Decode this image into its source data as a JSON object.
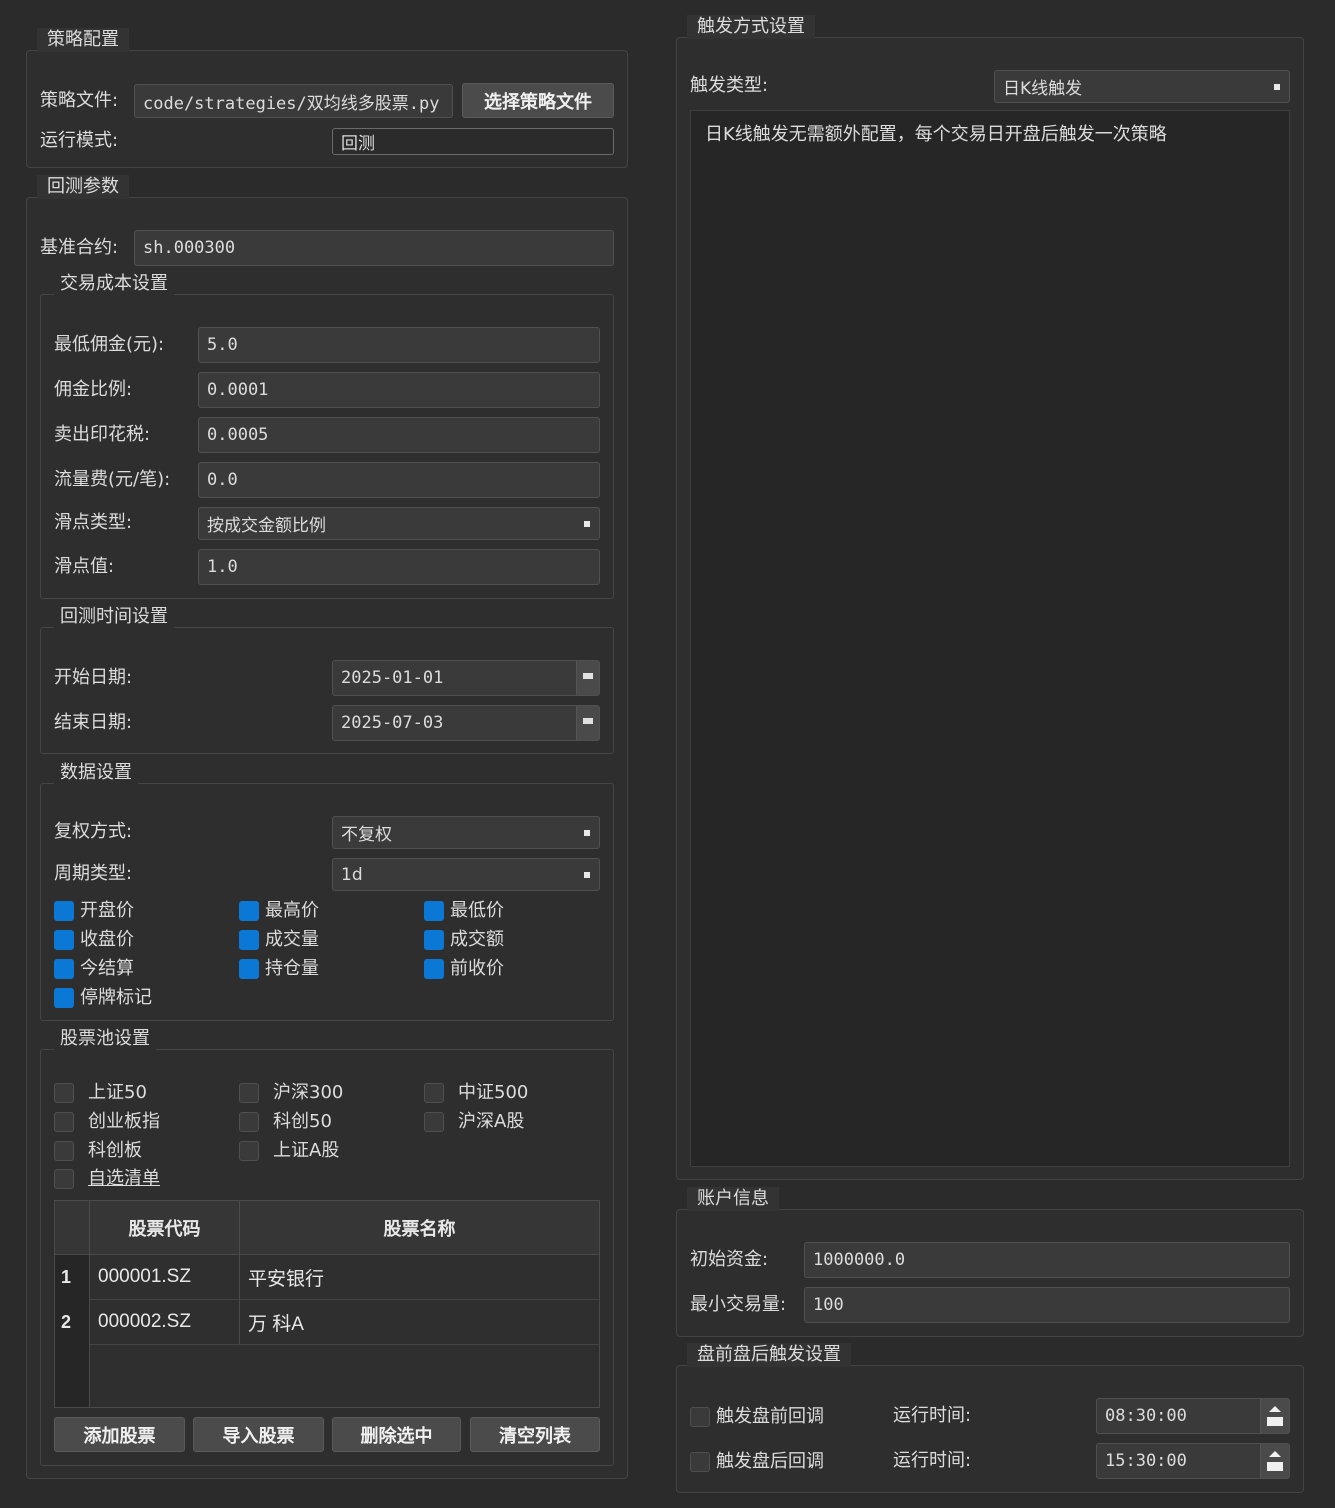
{
  "strategy": {
    "title": "策略配置",
    "file_label": "策略文件:",
    "file_value": "code/strategies/双均线多股票.py",
    "choose_button": "选择策略文件",
    "mode_label": "运行模式:",
    "mode_value": "回测"
  },
  "backtest": {
    "title": "回测参数",
    "benchmark_label": "基准合约:",
    "benchmark_value": "sh.000300",
    "cost": {
      "title": "交易成本设置",
      "min_commission_label": "最低佣金(元):",
      "min_commission_value": "5.0",
      "commission_rate_label": "佣金比例:",
      "commission_rate_value": "0.0001",
      "stamp_tax_label": "卖出印花税:",
      "stamp_tax_value": "0.0005",
      "flow_fee_label": "流量费(元/笔):",
      "flow_fee_value": "0.0",
      "slippage_type_label": "滑点类型:",
      "slippage_type_value": "按成交金额比例",
      "slippage_value_label": "滑点值:",
      "slippage_value_value": "1.0"
    },
    "time": {
      "title": "回测时间设置",
      "start_label": "开始日期:",
      "start_value": "2025-01-01",
      "end_label": "结束日期:",
      "end_value": "2025-07-03"
    },
    "data": {
      "title": "数据设置",
      "adjust_label": "复权方式:",
      "adjust_value": "不复权",
      "period_label": "周期类型:",
      "period_value": "1d",
      "fields": [
        {
          "label": "开盘价",
          "checked": true
        },
        {
          "label": "最高价",
          "checked": true
        },
        {
          "label": "最低价",
          "checked": true
        },
        {
          "label": "收盘价",
          "checked": true
        },
        {
          "label": "成交量",
          "checked": true
        },
        {
          "label": "成交额",
          "checked": true
        },
        {
          "label": "今结算",
          "checked": true
        },
        {
          "label": "持仓量",
          "checked": true
        },
        {
          "label": "前收价",
          "checked": true
        },
        {
          "label": "停牌标记",
          "checked": true
        }
      ]
    },
    "pool": {
      "title": "股票池设置",
      "options": [
        {
          "label": "上证50",
          "checked": false
        },
        {
          "label": "沪深300",
          "checked": false
        },
        {
          "label": "中证500",
          "checked": false
        },
        {
          "label": "创业板指",
          "checked": false
        },
        {
          "label": "科创50",
          "checked": false
        },
        {
          "label": "沪深A股",
          "checked": false
        },
        {
          "label": "科创板",
          "checked": false
        },
        {
          "label": "上证A股",
          "checked": false
        },
        {
          "label": "自选清单",
          "checked": false
        }
      ],
      "columns": [
        "股票代码",
        "股票名称"
      ],
      "rows": [
        {
          "index": "1",
          "code": "000001.SZ",
          "name": "平安银行"
        },
        {
          "index": "2",
          "code": "000002.SZ",
          "name": "万 科A"
        }
      ],
      "buttons": [
        "添加股票",
        "导入股票",
        "删除选中",
        "清空列表"
      ]
    }
  },
  "trigger": {
    "title": "触发方式设置",
    "type_label": "触发类型:",
    "type_value": "日K线触发",
    "description": "日K线触发无需额外配置，每个交易日开盘后触发一次策略"
  },
  "account": {
    "title": "账户信息",
    "capital_label": "初始资金:",
    "capital_value": "1000000.0",
    "min_volume_label": "最小交易量:",
    "min_volume_value": "100"
  },
  "prepost": {
    "title": "盘前盘后触发设置",
    "pre_label": "触发盘前回调",
    "pre_checked": false,
    "pre_time_label": "运行时间:",
    "pre_time_value": "08:30:00",
    "post_label": "触发盘后回调",
    "post_checked": false,
    "post_time_label": "运行时间:",
    "post_time_value": "15:30:00"
  }
}
